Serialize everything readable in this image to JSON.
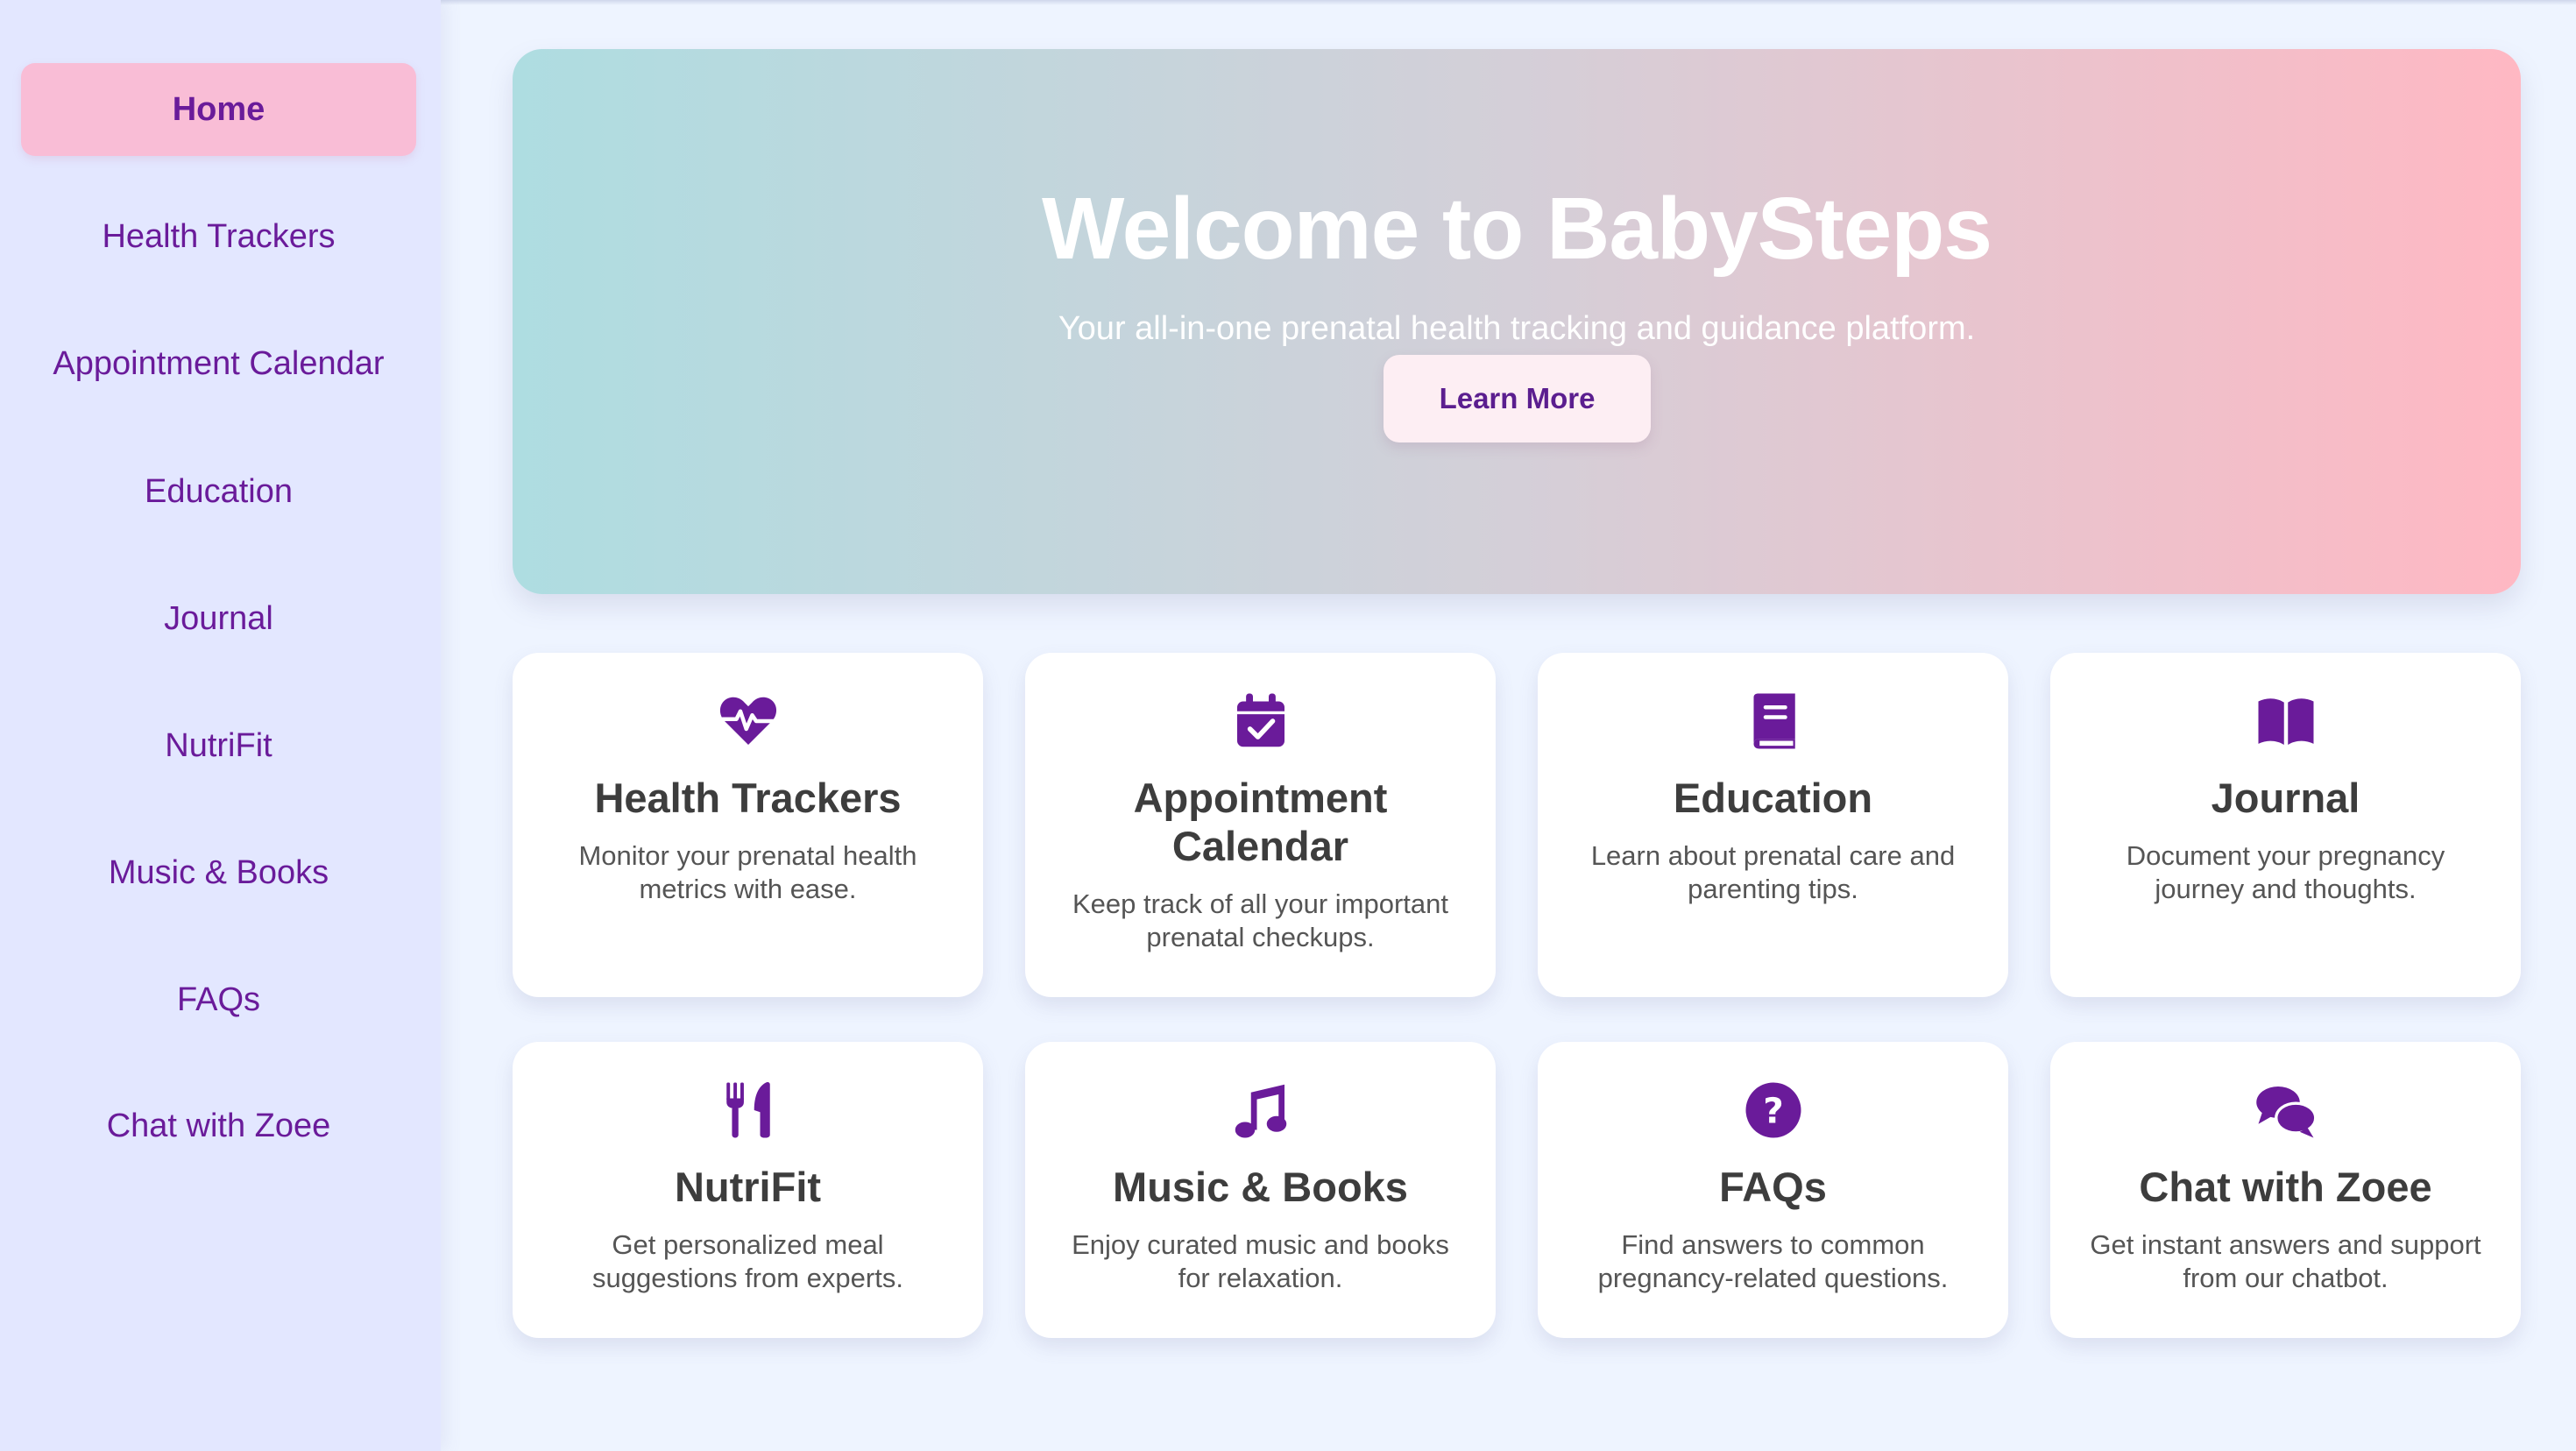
{
  "colors": {
    "accent": "#6a1b9a",
    "active_nav_bg": "#f9bdd6",
    "sidebar_bg": "#e3e7ff",
    "hero_gradient_start": "#aedde1",
    "hero_gradient_end": "#ffb8c3"
  },
  "sidebar": {
    "items": [
      {
        "label": "Home",
        "active": true
      },
      {
        "label": "Health Trackers"
      },
      {
        "label": "Appointment Calendar"
      },
      {
        "label": "Education"
      },
      {
        "label": "Journal"
      },
      {
        "label": "NutriFit"
      },
      {
        "label": "Music & Books"
      },
      {
        "label": "FAQs"
      },
      {
        "label": "Chat with Zoee"
      }
    ]
  },
  "hero": {
    "title": "Welcome to BabySteps",
    "subtitle": "Your all-in-one prenatal health tracking and guidance platform.",
    "button_label": "Learn More"
  },
  "cards": [
    {
      "icon": "heartbeat-icon",
      "title": "Health Trackers",
      "description": "Monitor your prenatal health metrics with ease."
    },
    {
      "icon": "calendar-check-icon",
      "title": "Appointment Calendar",
      "description": "Keep track of all your important prenatal checkups."
    },
    {
      "icon": "book-icon",
      "title": "Education",
      "description": "Learn about prenatal care and parenting tips."
    },
    {
      "icon": "book-open-icon",
      "title": "Journal",
      "description": "Document your pregnancy journey and thoughts."
    },
    {
      "icon": "utensils-icon",
      "title": "NutriFit",
      "description": "Get personalized meal suggestions from experts."
    },
    {
      "icon": "music-icon",
      "title": "Music & Books",
      "description": "Enjoy curated music and books for relaxation."
    },
    {
      "icon": "question-circle-icon",
      "title": "FAQs",
      "description": "Find answers to common pregnancy-related questions."
    },
    {
      "icon": "comments-icon",
      "title": "Chat with Zoee",
      "description": "Get instant answers and support from our chatbot."
    }
  ]
}
